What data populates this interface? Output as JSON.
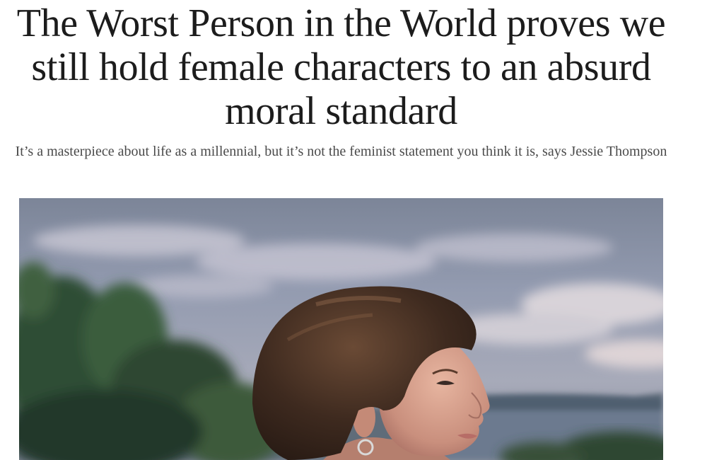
{
  "article": {
    "headline": "The Worst Person in the World proves we still hold female characters to an absurd moral standard",
    "standfirst": "It’s a masterpiece about life as a millennial, but it’s not the feminist statement you think it is, says Jessie Thompson"
  },
  "hero_image": {
    "subject": "woman-with-short-brown-hair-outdoors-at-dusk"
  }
}
